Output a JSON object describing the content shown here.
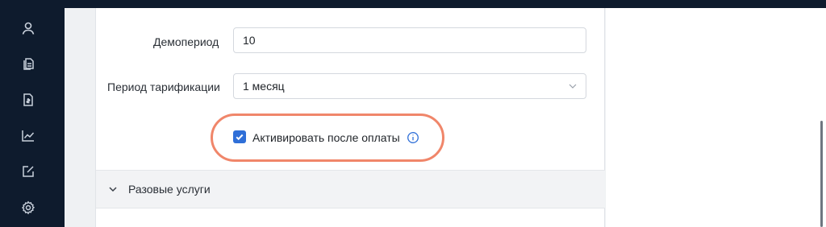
{
  "sidebar": {
    "items": [
      {
        "icon": "user-icon"
      },
      {
        "icon": "documents-icon"
      },
      {
        "icon": "invoice-icon"
      },
      {
        "icon": "chart-icon"
      },
      {
        "icon": "edit-icon"
      },
      {
        "icon": "gear-icon"
      }
    ],
    "icon_color": "#c9d1dc"
  },
  "form": {
    "demo_label": "Демопериод",
    "demo_value": "10",
    "billing_label": "Период тарификации",
    "billing_value": "1 месяц",
    "activate_label": "Активировать после оплаты",
    "activate_checked": true
  },
  "section": {
    "title": "Разовые услуги",
    "expanded": false
  },
  "colors": {
    "sidebar_bg": "#0e1b2d",
    "accent": "#2f6fd8",
    "highlight": "#f0866a"
  }
}
